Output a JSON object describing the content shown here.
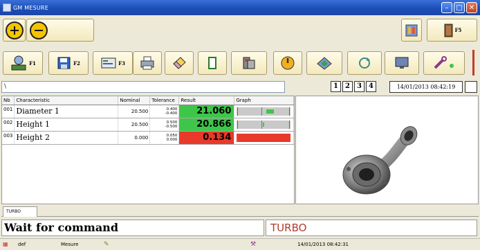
{
  "window": {
    "title": "GM MESURE"
  },
  "toolbar1": {
    "plus_icon": "plus-circle-icon",
    "minus_icon": "minus-circle-icon",
    "config_icon": "config-icon",
    "exit_label": "F5"
  },
  "toolbar2": {
    "keys": [
      {
        "label": "F1",
        "icon": "operator-icon"
      },
      {
        "label": "F2",
        "icon": "save-icon"
      },
      {
        "label": "F3",
        "icon": "report-icon"
      },
      {
        "label": "",
        "icon": "printer-icon"
      },
      {
        "label": "",
        "icon": "eraser-icon"
      },
      {
        "label": "",
        "icon": "battery-icon"
      },
      {
        "label": "",
        "icon": "measure-tool-icon"
      },
      {
        "label": "",
        "icon": "power-icon"
      },
      {
        "label": "",
        "icon": "calibrate-icon"
      },
      {
        "label": "",
        "icon": "sync-icon"
      },
      {
        "label": "",
        "icon": "monitor-icon"
      },
      {
        "label": "",
        "icon": "tools-icon"
      }
    ]
  },
  "path": {
    "value": "\\"
  },
  "pages": [
    "1",
    "2",
    "3",
    "4"
  ],
  "datetime": "14/01/2013 08:42:19",
  "table": {
    "headers": {
      "nb": "Nb",
      "characteristic": "Characteristic",
      "nominal": "Nominal",
      "tolerance": "Tolerance",
      "result": "Result",
      "graph": "Graph"
    },
    "rows": [
      {
        "nb": "001",
        "characteristic": "Diameter 1",
        "nominal": "20.500",
        "tol_plus": "0.400",
        "tol_minus": "-0.400",
        "result": "21.060",
        "status": "ok"
      },
      {
        "nb": "002",
        "characteristic": "Height 1",
        "nominal": "20.500",
        "tol_plus": "0.500",
        "tol_minus": "-0.500",
        "result": "20.866",
        "status": "ok"
      },
      {
        "nb": "003",
        "characteristic": "Height 2",
        "nominal": "0.000",
        "tol_plus": "0.050",
        "tol_minus": "0.000",
        "result": "0.134",
        "status": "bad"
      }
    ]
  },
  "tab": {
    "label": "TURBO"
  },
  "message": {
    "text": "Wait for command"
  },
  "part_name": "TURBO",
  "status": {
    "user": "def",
    "mode": "Mesure",
    "datetime": "14/01/2013  08:42:31"
  },
  "colors": {
    "ok": "#3ec64a",
    "bad": "#e8392b",
    "title": "#1a4fb8"
  }
}
